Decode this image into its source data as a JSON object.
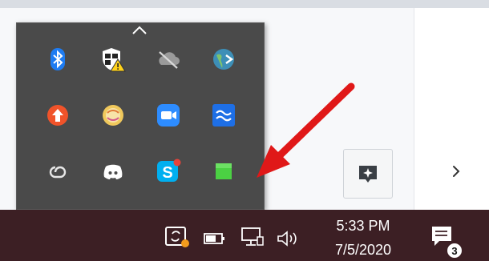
{
  "tray_overflow": {
    "icons": [
      {
        "name": "bluetooth-icon",
        "color": "#1e7cf2"
      },
      {
        "name": "windows-security-warning-icon",
        "color": "#ffd21a"
      },
      {
        "name": "onedrive-offline-icon",
        "color": "#c9c9c9"
      },
      {
        "name": "network-globe-icon",
        "color": "#3d8fb7"
      },
      {
        "name": "upload-arrow-icon",
        "color": "#f0532a"
      },
      {
        "name": "circle-app-icon",
        "color": "#f0c85c"
      },
      {
        "name": "zoom-icon",
        "color": "#2d8cff"
      },
      {
        "name": "waves-app-icon",
        "color": "#1e6fe6"
      },
      {
        "name": "creative-cloud-icon",
        "color": "#e0e0e0"
      },
      {
        "name": "discord-icon",
        "color": "#ffffff"
      },
      {
        "name": "skype-icon",
        "color": "#00aff0"
      },
      {
        "name": "green-square-icon",
        "color": "#4bd143"
      }
    ]
  },
  "taskbar": {
    "clock_time": "5:33 PM",
    "clock_date": "7/5/2020",
    "notification_count": "3",
    "icons": [
      "chevron-up-icon",
      "sync-status-icon",
      "battery-icon",
      "network-icon",
      "volume-icon"
    ]
  },
  "accent": {
    "arrow_color": "#e01818",
    "taskbar_bg": "#3c1f24"
  }
}
